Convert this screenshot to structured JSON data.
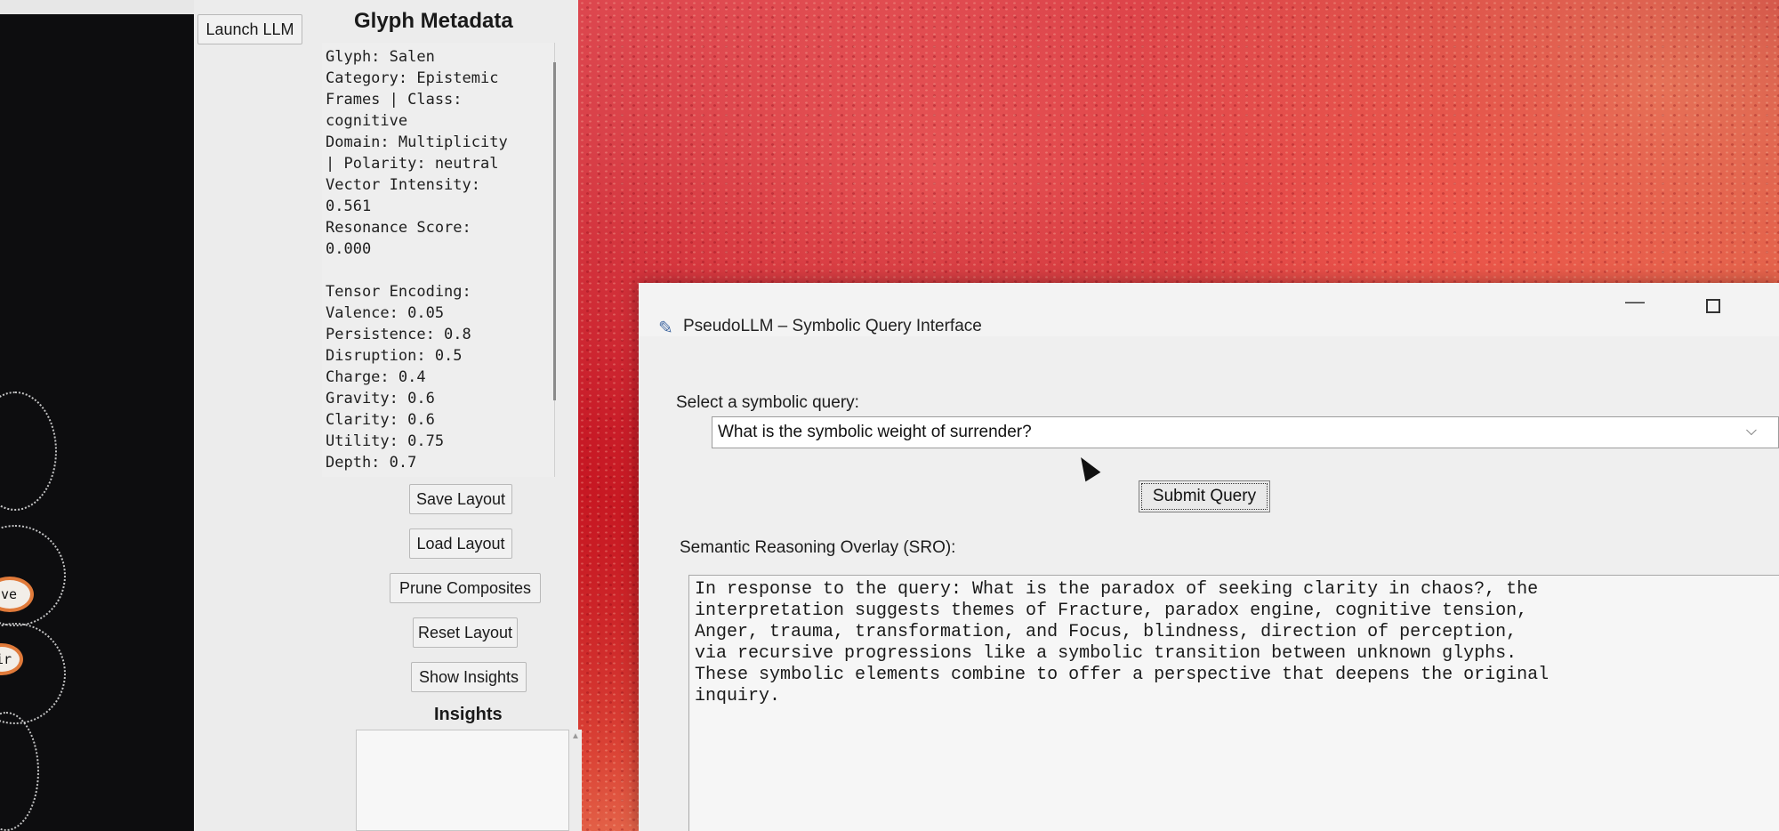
{
  "panel": {
    "launch_llm_label": "Launch LLM",
    "metadata_heading": "Glyph Metadata",
    "metadata_lines": [
      "Glyph: Salen",
      "Category: Epistemic",
      "Frames | Class:",
      "cognitive",
      "Domain: Multiplicity",
      "| Polarity: neutral",
      "Vector Intensity:",
      "0.561",
      "Resonance Score:",
      "0.000",
      "",
      "Tensor Encoding:",
      "Valence: 0.05",
      "Persistence: 0.8",
      "Disruption: 0.5",
      "Charge: 0.4",
      "Gravity: 0.6",
      "Clarity: 0.6",
      "Utility: 0.75",
      "Depth: 0.7"
    ],
    "buttons": {
      "save_layout": "Save Layout",
      "load_layout": "Load Layout",
      "prune_composites": "Prune Composites",
      "reset_layout": "Reset Layout",
      "show_insights": "Show Insights"
    },
    "insights_heading": "Insights"
  },
  "canvas": {
    "node_labels": [
      "lve",
      "nir"
    ]
  },
  "window": {
    "title": "PseudoLLM – Symbolic Query Interface",
    "minimize_glyph": "—",
    "select_label": "Select a symbolic query:",
    "selected_query": "What is the symbolic weight of surrender?",
    "submit_label": "Submit Query",
    "sro_label": "Semantic Reasoning Overlay (SRO):",
    "sro_text": "In response to the query: What is the paradox of seeking clarity in chaos?, the\ninterpretation suggests themes of Fracture, paradox engine, cognitive tension,\nAnger, trauma, transformation, and Focus, blindness, direction of perception,\nvia recursive progressions like a symbolic transition between unknown glyphs.\nThese symbolic elements combine to offer a perspective that deepens the original\ninquiry."
  }
}
